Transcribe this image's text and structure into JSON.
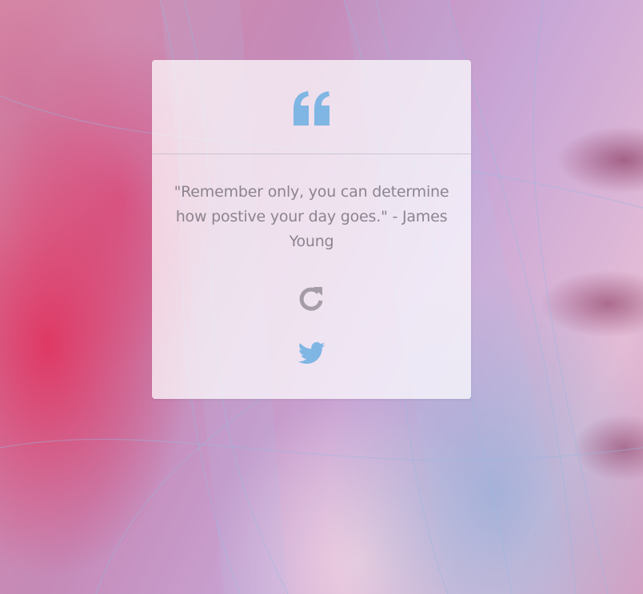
{
  "quote": {
    "text": "\"Remember only, you can determine how postive your day goes.\" - James Young"
  },
  "icons": {
    "quote": "quote-left-icon",
    "refresh": "refresh-icon",
    "tweet": "twitter-icon"
  },
  "colors": {
    "accent_blue": "#7fb6e4",
    "quote_text": "#8c8490",
    "refresh_icon": "#a49ca6",
    "card_background": "rgba(255,255,255,0.72)"
  }
}
